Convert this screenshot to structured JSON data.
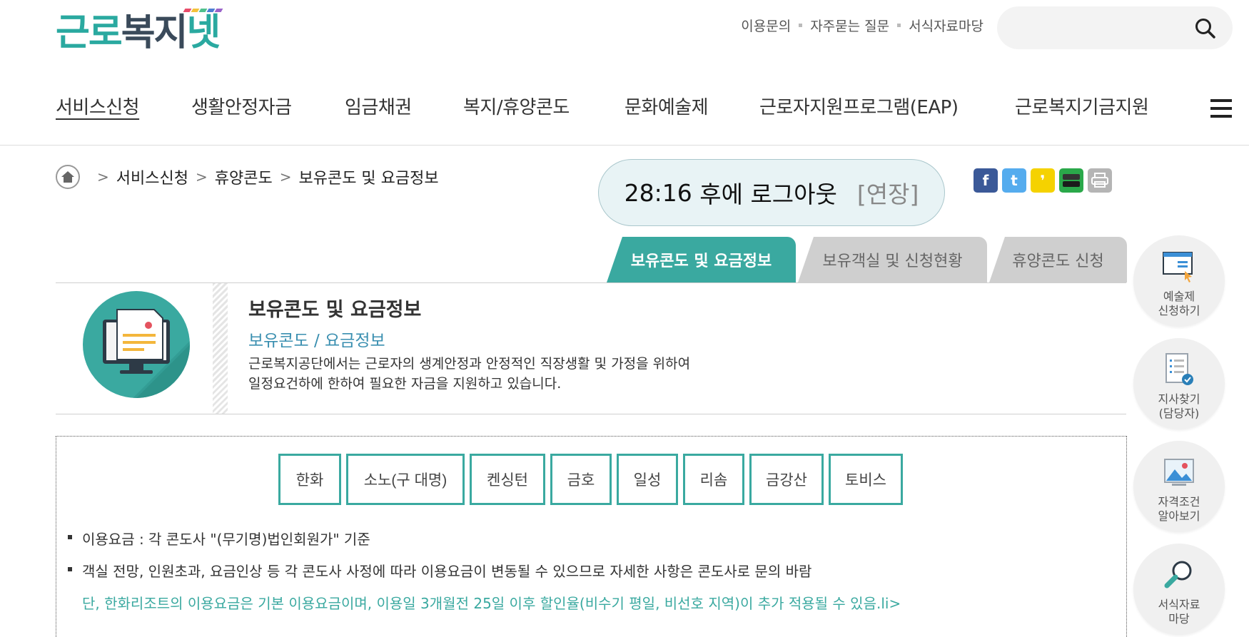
{
  "header": {
    "logo": "근로복지넷",
    "logo_stripes": [
      "#e84c6a",
      "#f3c23b",
      "#4fc08d",
      "#4e7ed3",
      "#9a63c9"
    ],
    "util_links": [
      "이용문의",
      "자주묻는 질문",
      "서식자료마당"
    ],
    "search": {
      "placeholder": "",
      "icon": "search-icon"
    }
  },
  "gnb": {
    "items": [
      "서비스신청",
      "생활안정자금",
      "임금채권",
      "복지/휴양콘도",
      "문화예술제",
      "근로자지원프로그램(EAP)",
      "근로복지기금지원"
    ],
    "active_index": 0,
    "menu_icon": "hamburger-icon"
  },
  "breadcrumb": {
    "home_icon": "home-icon",
    "items": [
      "서비스신청",
      "휴양콘도",
      "보유콘도 및 요금정보"
    ]
  },
  "session": {
    "time": "28:16",
    "text": "후에 로그아웃",
    "extend": "[연장]"
  },
  "share": {
    "icons": [
      {
        "name": "facebook-icon",
        "glyph": "f",
        "color": "#3b5998"
      },
      {
        "name": "twitter-icon",
        "glyph": "t",
        "color": "#55acee"
      },
      {
        "name": "kakao-story-icon",
        "glyph": "❜",
        "color": "#f5d200"
      },
      {
        "name": "band-icon",
        "glyph": "",
        "color": "#2aa84a"
      },
      {
        "name": "print-icon",
        "glyph": "",
        "color": "#b5b5b5"
      }
    ]
  },
  "tabs": [
    "보유콘도 및 요금정보",
    "보유객실 및 신청현황",
    "휴양콘도 신청"
  ],
  "intro": {
    "title": "보유콘도 및 요금정보",
    "subtitle": "보유콘도 / 요금정보",
    "desc_line1": "근로복지공단에서는 근로자의 생계안정과 안정적인 직장생활 및 가정을 위하여",
    "desc_line2": "일정요건하에 한하여 필요한 자금을 지원하고 있습니다."
  },
  "condos": [
    "한화",
    "소노(구 대명)",
    "켄싱턴",
    "금호",
    "일성",
    "리솜",
    "금강산",
    "토비스"
  ],
  "notes": {
    "line1": "이용요금 : 각 콘도사 \"(무기명)법인회원가\" 기준",
    "line2": "객실 전망, 인원초과, 요금인상 등 각 콘도사 사정에 따라 이용요금이 변동될 수 있으므로 자세한 사항은 콘도사로 문의 바람",
    "line3": "단, 한화리조트의 이용요금은 기본 이용요금이며, 이용일 3개월전 25일 이후 할인율(비수기 평일, 비선호 지역)이 추가 적용될 수 있음.li>"
  },
  "quick_menu": [
    {
      "line1": "예술제",
      "line2": "신청하기"
    },
    {
      "line1": "지사찾기",
      "line2": "(담당자)"
    },
    {
      "line1": "자격조건",
      "line2": "알아보기"
    },
    {
      "line1": "서식자료",
      "line2": "마당"
    }
  ],
  "colors": {
    "accent": "#3aa9a0",
    "link": "#3a8fb0",
    "tab_inactive": "#cfcfcf"
  }
}
